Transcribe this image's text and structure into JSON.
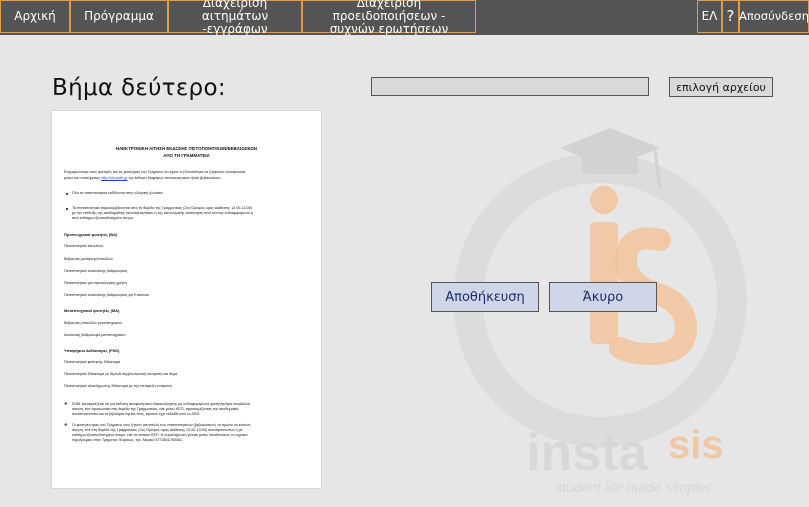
{
  "nav": {
    "home": "Αρχική",
    "schedule": "Πρόγραμμα",
    "requests_line1": "Διαχείριση",
    "requests_line2": "αιτημάτων -εγγράφων",
    "warnings_line1": "Διαχείριση προειδοποιήσεων -",
    "warnings_line2": "συχνών ερωτήσεων",
    "language": "ΕΛ",
    "help": "?",
    "logout": "Αποσύνδεση"
  },
  "colors": {
    "nav_bg": "#545454",
    "nav_border": "#e09a4c",
    "page_bg": "#e6e6e6",
    "button_bg": "#cfd6e8",
    "button_text": "#1b2d6b",
    "watermark_orange": "#f3c39a",
    "watermark_gray": "#d2d2d2"
  },
  "step_title": "Βήμα δεύτερο:",
  "file_picker": {
    "button_label": "επιλογή αρχείου",
    "value": ""
  },
  "actions": {
    "save": "Αποθήκευση",
    "cancel": "Άκυρο"
  },
  "watermark": {
    "brand": "instasis",
    "tagline": "student life made simpler"
  },
  "document": {
    "title_line1": "ΗΛΕΚΤΡΟΝΙΚΗ ΑΙΤΗΣΗ ΕΚΔΟΣΗΣ ΠΙΣΤΟΠΟΙΗΤΙΚΩΝ/ΒΕΒΑΙΩΣΕΩΝ",
    "title_line2": "ΑΠΟ ΤΗ ΓΡΑΜΜΑΤΕΙΑ",
    "intro_line1": "Ενημερώνουμε τους φοιτητές και τις φοιτήτριες του Τμήματος ότι έχουν τη δυνατότητα να ζητήσουν ηλεκτρονικά,",
    "intro_line2_a": "μέσω του συστήματος ",
    "intro_link": "http://sis.auth.gr",
    "intro_line2_b": " την έκδοση διαφόρων πιστοποιητικών ή/και βεβαιώσεων.",
    "bullet1": "Όλα τα πιστοποιητικά εκδίδονται στην ελληνική γλώσσα.",
    "bullet2_line1": "Τα πιστοποιητικά παραλαμβάνονται από τη θυρίδα της Γραμματείας (2ος Όροφος ώρες Διάθεσης 12.00-13.00)",
    "bullet2_line2": "με την επίδειξη της ακαδημαϊκής ταυτότητας/πάσο ή της αστυνομικής ταυτότητας από τον/την ενδιαφερόμενο/-η",
    "bullet2_line3": "από επίσημα εξουσιοδοτημένο άτομο.",
    "sec1": "Προπτυχιακοί φοιτητές (BA)",
    "sec1_items": [
      "Πιστοποιητικό σπουδών",
      "Βεβαίωση φοίτησης/σπουδών",
      "Πιστοποιητικό αναλυτικής βαθμολογίας",
      "Πιστοποιητικό για στρατολογική χρήση",
      "Πιστοποιητικό αναλυτικής βαθμολογίας για Erasmus"
    ],
    "sec2": "Μεταπτυχιακοί φοιτητές (MA)",
    "sec2_items": [
      "Βεβαίωση σπουδών μεταπτυχιακού",
      "Αναλυτική βαθμολογία μεταπτυχιακού"
    ],
    "sec3": "Υποψήφιοι Διδάκτορες (PhD)",
    "sec3_items": [
      "Πιστοποιητικό φοίτησης διδάκτορα",
      "Πιστοποιητικό διδάκτορα με δηλωθ συμβουλευτική επιτροπή και θέμα",
      "Πιστοποιητικό ολοκλήρωσης διδάκτορα με την επταμελή επιτροπή"
    ],
    "note1_line1": "ΣΗΜ. Διευκρινίζεται ότι για έκδοση αποφοιτητικού-δικαιολόγησης μη ενδιαφερόμενος φοιτητής/τρια υποβάλλει",
    "note1_line2": "αίτηση, είτε προσωπικά στη θυρίδα της Γραμματείας, είτε μέσω ΚΕΠ, προσκομίζοντας την ακαδημαϊκή",
    "note1_line3": "ταυτότητα/πάσο και τα βιβλιάρια υγείας τους, εφόσον έχει εκδοθεί από το ΑΠΘ.",
    "note2_line1": "Οι φοιτητές/τριες του Τμήματος που ζητούν αποστολή των πιστοποιητικών (βεβαιώσεων) το πρώτο να κάνουν",
    "note2_line2": "αίτηση, είτε στη θυρίδα της Γραμματείας (2ος Όροφος ώρες Διάθεσης 12.00-13.00) αυτοπροσώπως ή με",
    "note2_line3": "επίσημα εξουσιοδοτημένο άτομο, είτε σε κάποιο ΚΕΠ. Η συμπλήρωση γίνεται μέσω διευθύνσεων το σχετικό",
    "note2_line4": "ταχυδρομείο στην Τμήματος Πειραιώς, τηλ. Μερικό 5773841780361."
  }
}
